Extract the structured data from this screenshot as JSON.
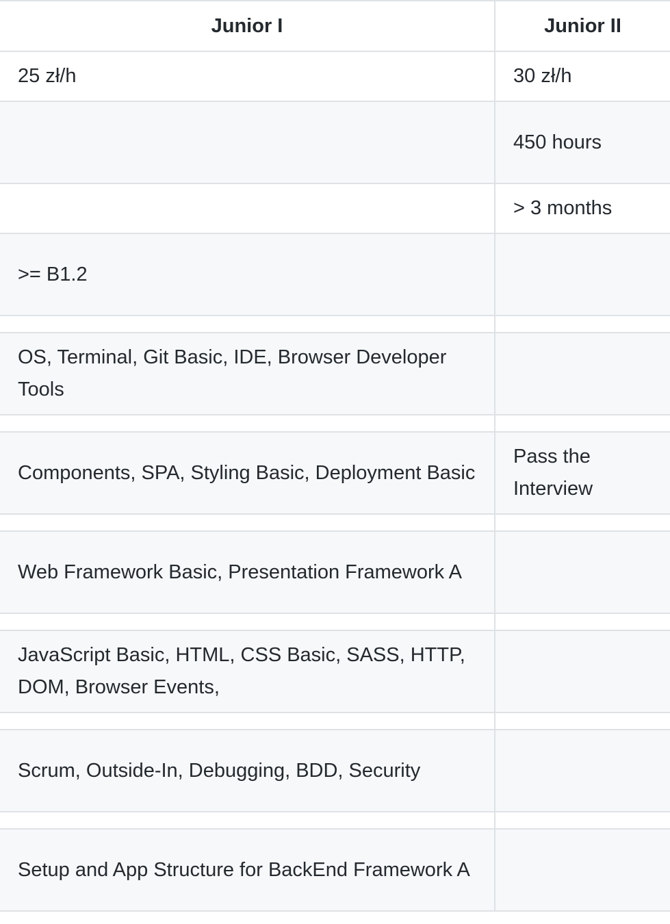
{
  "table": {
    "headers": [
      "Junior I",
      "Junior II"
    ],
    "rows": [
      [
        "25 zł/h",
        "30 zł/h"
      ],
      [
        "",
        "450 hours"
      ],
      [
        "",
        "> 3 months"
      ],
      [
        ">= B1.2",
        ""
      ],
      [
        "",
        ""
      ],
      [
        "OS, Terminal, Git Basic, IDE, Browser Developer Tools",
        ""
      ],
      [
        "",
        ""
      ],
      [
        "Components, SPA, Styling Basic, Deployment Basic",
        "Pass the Interview"
      ],
      [
        "",
        ""
      ],
      [
        "Web Framework Basic, Presentation Framework A",
        ""
      ],
      [
        "",
        ""
      ],
      [
        "JavaScript Basic, HTML, CSS Basic, SASS, HTTP, DOM, Browser Events,",
        ""
      ],
      [
        "",
        ""
      ],
      [
        "Scrum, Outside-In, Debugging, BDD, Security",
        ""
      ],
      [
        "",
        ""
      ],
      [
        "Setup and App Structure for BackEnd Framework A",
        ""
      ]
    ]
  }
}
